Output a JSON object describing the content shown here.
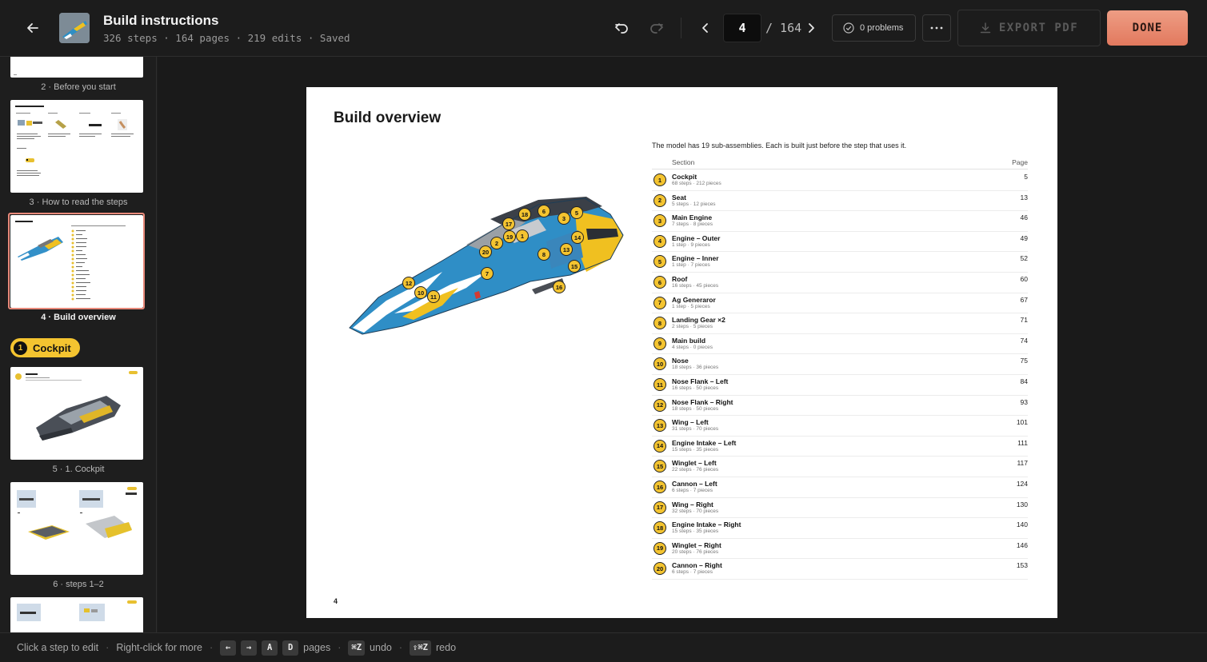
{
  "header": {
    "title": "Build instructions",
    "meta": "326 steps · 164 pages · 219 edits · Saved",
    "current_page": "4",
    "total_pages": "/ 164",
    "problems_label": "0 problems",
    "export_label": "EXPORT PDF",
    "done_label": "DONE"
  },
  "sidebar": {
    "thumbs": [
      {
        "label": "2 · Before you start"
      },
      {
        "label": "3 · How to read the steps"
      },
      {
        "label": "4 · Build overview"
      },
      {
        "label": "5 · 1. Cockpit"
      },
      {
        "label": "6 · steps 1–2"
      }
    ],
    "section_chip": {
      "number": "1",
      "label": "Cockpit"
    }
  },
  "page": {
    "heading": "Build overview",
    "intro": "The model has 19 sub-assemblies. Each is built just before the step that uses it.",
    "col_section": "Section",
    "col_page": "Page",
    "page_number": "4",
    "sections": [
      {
        "num": "1",
        "name": "Cockpit",
        "sub": "68 steps · 212 pieces",
        "page": "5"
      },
      {
        "num": "2",
        "name": "Seat",
        "sub": "5 steps · 12 pieces",
        "page": "13"
      },
      {
        "num": "3",
        "name": "Main Engine",
        "sub": "7 steps · 8 pieces",
        "page": "46"
      },
      {
        "num": "4",
        "name": "Engine – Outer",
        "sub": "1 step · 9 pieces",
        "page": "49"
      },
      {
        "num": "5",
        "name": "Engine – Inner",
        "sub": "1 step · 7 pieces",
        "page": "52"
      },
      {
        "num": "6",
        "name": "Roof",
        "sub": "16 steps · 45 pieces",
        "page": "60"
      },
      {
        "num": "7",
        "name": "Ag Generaror",
        "sub": "1 step · 5 pieces",
        "page": "67"
      },
      {
        "num": "8",
        "name": "Landing Gear ×2",
        "sub": "2 steps · 5 pieces",
        "page": "71"
      },
      {
        "num": "9",
        "name": "Main build",
        "sub": "4 steps · 0 pieces",
        "page": "74"
      },
      {
        "num": "10",
        "name": "Nose",
        "sub": "18 steps · 36 pieces",
        "page": "75"
      },
      {
        "num": "11",
        "name": "Nose Flank – Left",
        "sub": "16 steps · 50 pieces",
        "page": "84"
      },
      {
        "num": "12",
        "name": "Nose Flank – Right",
        "sub": "18 steps · 50 pieces",
        "page": "93"
      },
      {
        "num": "13",
        "name": "Wing – Left",
        "sub": "31 steps · 70 pieces",
        "page": "101"
      },
      {
        "num": "14",
        "name": "Engine Intake – Left",
        "sub": "15 steps · 35 pieces",
        "page": "111"
      },
      {
        "num": "15",
        "name": "Winglet – Left",
        "sub": "22 steps · 76 pieces",
        "page": "117"
      },
      {
        "num": "16",
        "name": "Cannon – Left",
        "sub": "6 steps · 7 pieces",
        "page": "124"
      },
      {
        "num": "17",
        "name": "Wing – Right",
        "sub": "32 steps · 70 pieces",
        "page": "130"
      },
      {
        "num": "18",
        "name": "Engine Intake – Right",
        "sub": "15 steps · 35 pieces",
        "page": "140"
      },
      {
        "num": "19",
        "name": "Winglet – Right",
        "sub": "20 steps · 76 pieces",
        "page": "146"
      },
      {
        "num": "20",
        "name": "Cannon – Right",
        "sub": "6 steps · 7 pieces",
        "page": "153"
      }
    ],
    "callouts": [
      "17",
      "18",
      "6",
      "3",
      "5",
      "1",
      "19",
      "2",
      "14",
      "20",
      "8",
      "13",
      "7",
      "15",
      "12",
      "10",
      "11",
      "16"
    ]
  },
  "status": {
    "hint1": "Click a step to edit",
    "hint2": "Right-click for more",
    "key_left": "←",
    "key_right": "→",
    "key_a": "A",
    "key_d": "D",
    "pages_label": "pages",
    "undo_key": "⌘Z",
    "undo_label": "undo",
    "redo_key": "⇧⌘Z",
    "redo_label": "redo"
  }
}
